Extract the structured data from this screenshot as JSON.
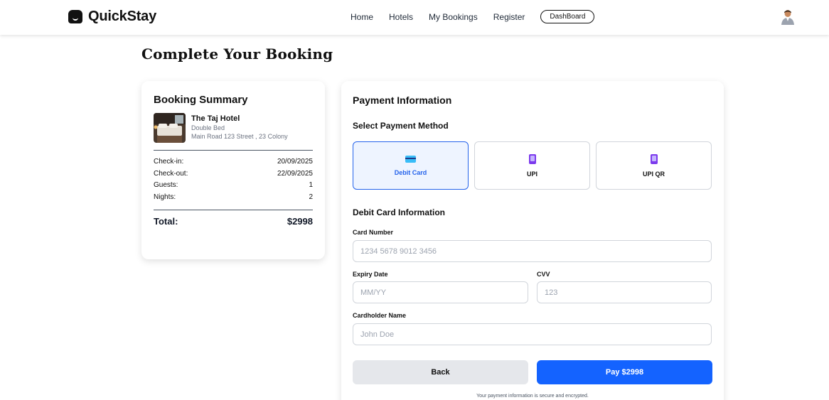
{
  "header": {
    "brand": "QuickStay",
    "nav": [
      "Home",
      "Hotels",
      "My Bookings",
      "Register"
    ],
    "dashboard_label": "DashBoard"
  },
  "page": {
    "title": "Complete Your Booking"
  },
  "summary": {
    "title": "Booking Summary",
    "hotel_name": "The Taj Hotel",
    "room_type": "Double Bed",
    "address": "Main Road 123 Street , 23 Colony",
    "rows": [
      {
        "label": "Check-in:",
        "value": "20/09/2025"
      },
      {
        "label": "Check-out:",
        "value": "22/09/2025"
      },
      {
        "label": "Guests:",
        "value": "1"
      },
      {
        "label": "Nights:",
        "value": "2"
      }
    ],
    "total_label": "Total:",
    "total_value": "$2998"
  },
  "payment": {
    "title": "Payment Information",
    "method_title": "Select Payment Method",
    "methods": [
      {
        "label": "Debit Card",
        "icon": "credit-card-icon",
        "selected": true
      },
      {
        "label": "UPI",
        "icon": "mobile-phone-icon",
        "selected": false
      },
      {
        "label": "UPI QR",
        "icon": "mobile-phone-icon",
        "selected": false
      }
    ],
    "section_title": "Debit Card Information",
    "card_number_label": "Card Number",
    "card_number_placeholder": "1234 5678 9012 3456",
    "expiry_label": "Expiry Date",
    "expiry_placeholder": "MM/YY",
    "cvv_label": "CVV",
    "cvv_placeholder": "123",
    "holder_label": "Cardholder Name",
    "holder_placeholder": "John Doe",
    "back_label": "Back",
    "pay_label": "Pay $2998",
    "secure_note": "Your payment information is secure and encrypted."
  },
  "colors": {
    "primary": "#1463ff",
    "selected_border": "#2563eb",
    "back_button": "#e5e7eb"
  }
}
